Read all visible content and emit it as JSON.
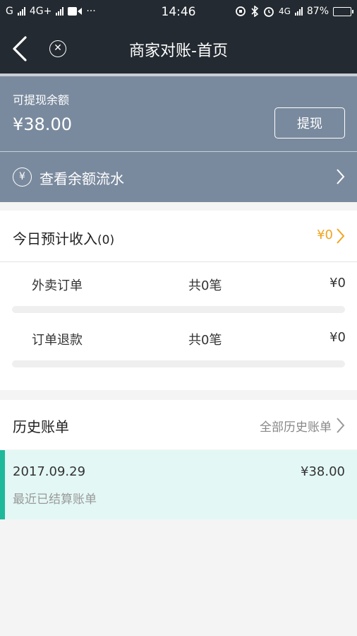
{
  "status": {
    "carrier1": "G",
    "carrier2": "4G+",
    "time": "14:46",
    "net": "4G",
    "battery": "87%",
    "battery_level": 0.87
  },
  "nav": {
    "title": "商家对账-首页"
  },
  "balance": {
    "label": "可提现余额",
    "amount": "¥38.00",
    "withdraw_label": "提现",
    "flow_yen": "¥",
    "flow_label": "查看余额流水"
  },
  "today": {
    "title": "今日预计收入",
    "count": "(0)",
    "amount": "¥0",
    "items": [
      {
        "name": "外卖订单",
        "count": "共0笔",
        "amount": "¥0",
        "progress": 0
      },
      {
        "name": "订单退款",
        "count": "共0笔",
        "amount": "¥0",
        "progress": 0
      }
    ]
  },
  "history": {
    "title": "历史账单",
    "all_label": "全部历史账单",
    "bill": {
      "date": "2017.09.29",
      "amount": "¥38.00",
      "subtitle": "最近已结算账单"
    }
  },
  "colors": {
    "header_bg": "#232a31",
    "balance_bg": "#7a8a9e",
    "accent_orange": "#f0a520",
    "accent_green": "#1db99a",
    "bill_bg": "#e3f8f5"
  }
}
